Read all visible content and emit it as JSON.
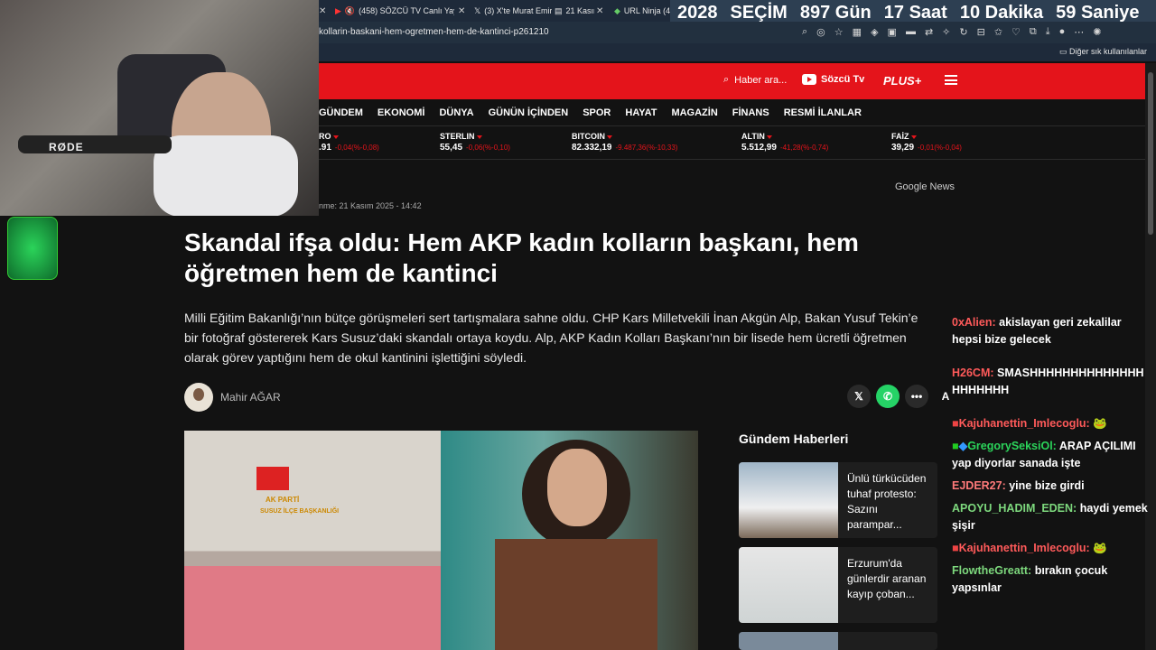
{
  "browser": {
    "tabs": [
      {
        "label": "(458) SÖZCÜ TV Canlı Yayın",
        "icon": "youtube-icon"
      },
      {
        "label": "(3) X'te Murat Emir: \"",
        "icon": "x-icon"
      },
      {
        "label": "21 Kasım",
        "icon": "news-icon"
      },
      {
        "label": "URL Ninja (4",
        "icon": "ninja-icon"
      }
    ],
    "url": "kollarin-baskani-hem-ogretmen-hem-de-kantinci-p261210",
    "bookmarks_label": "Diğer sık kullanılanlar"
  },
  "countdown": {
    "year": "2028",
    "label": "SEÇİM",
    "days": "897",
    "days_unit": "Gün",
    "hours": "17",
    "hours_unit": "Saat",
    "minutes": "10",
    "minutes_unit": "Dakika",
    "seconds": "59",
    "seconds_unit": "Saniye"
  },
  "header": {
    "search_placeholder": "Haber ara...",
    "tv_label": "Sözcü Tv",
    "plus_label": "PLUS+"
  },
  "nav": [
    "GÜNDEM",
    "EKONOMİ",
    "DÜNYA",
    "GÜNÜN İÇİNDEN",
    "SPOR",
    "HAYAT",
    "MAGAZİN",
    "FİNANS",
    "RESMİ İLANLAR"
  ],
  "ticker": [
    {
      "name": "RO",
      "value": ".91",
      "change": "-0,04(%-0,08)"
    },
    {
      "name": "STERLIN",
      "value": "55,45",
      "change": "-0,06(%-0,10)"
    },
    {
      "name": "BITCOIN",
      "value": "82.332,19",
      "change": "-9.487,36(%-10,33)"
    },
    {
      "name": "ALTIN",
      "value": "5.512,99",
      "change": "-41,28(%-0,74)"
    },
    {
      "name": "FAİZ",
      "value": "39,29",
      "change": "-0,01(%-0,04)"
    }
  ],
  "google_news": {
    "g": "Google",
    "n": "News"
  },
  "article": {
    "date": "nme: 21 Kasım 2025 - 14:42",
    "title": "Skandal ifşa oldu: Hem AKP kadın kolların başkanı, hem öğretmen hem de kantinci",
    "lead": "Milli Eğitim Bakanlığı’nın bütçe görüşmeleri sert tartışmalara sahne oldu. CHP Kars Milletvekili İnan Akgün Alp, Bakan Yusuf Tekin’e bir fotoğraf göstererek Kars Susuz’daki skandalı ortaya koydu. Alp, AKP Kadın Kolları Başkanı’nın bir lisede hem ücretli öğretmen olarak görev yaptığını hem de okul kantinini işlettiğini söyledi.",
    "author": "Mahir AĞAR",
    "photo_sign1": "AK PARTİ",
    "photo_sign2": "SUSUZ İLÇE BAŞKANLIĞI"
  },
  "sidebar": {
    "title": "Gündem Haberleri",
    "items": [
      {
        "title": "Ünlü türkücüden tuhaf protesto: Sazını parampar..."
      },
      {
        "title": "Erzurum'da günlerdir aranan kayıp çoban..."
      }
    ]
  },
  "webcam": {
    "mic_brand": "RØDE"
  },
  "chat": [
    {
      "user": "0xAlien:",
      "color": "#ff5a5a",
      "text": "akislayan geri zekalilar hepsi bize gelecek"
    },
    {
      "user": "H26CM:",
      "color": "#ff5a5a",
      "text": "SMASHHHHHHHHHHHHHHHHHHHHH"
    },
    {
      "user": "Kajuhanettin_Imlecoglu:",
      "color": "#ff5a5a",
      "text": ""
    },
    {
      "user": "GregorySeksiOl:",
      "color": "#2bd45a",
      "text": "ARAP AÇILIMI yap diyorlar sanada işte"
    },
    {
      "user": "EJDER27:",
      "color": "#ff7a7a",
      "text": "yine bize girdi"
    },
    {
      "user": "APOYU_HADIM_EDEN:",
      "color": "#7dd87d",
      "text": "haydi yemek şişir"
    },
    {
      "user": "Kajuhanettin_Imlecoglu:",
      "color": "#ff5a5a",
      "text": ""
    },
    {
      "user": "FlowtheGreatt:",
      "color": "#7dd87d",
      "text": "bırakın çocuk yapsınlar"
    }
  ]
}
